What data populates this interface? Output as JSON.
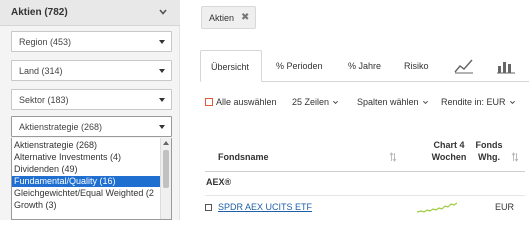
{
  "filter_panel": {
    "title": "Aktien (782)",
    "selects": {
      "region": "Region (453)",
      "land": "Land (314)",
      "sektor": "Sektor (183)",
      "strategie": "Aktienstrategie (268)"
    },
    "dropdown_options": [
      "Aktienstrategie (268)",
      "Alternative Investments (4)",
      "Dividenden (49)",
      "Fundamental/Quality (16)",
      "Gleichgewichtet/Equal Weighted (2",
      "Growth (3)"
    ],
    "selected_option_index": 3
  },
  "active_filter": {
    "label": "Aktien",
    "remove_symbol": "✖"
  },
  "tabs": {
    "overview": "Übersicht",
    "perioden": "% Perioden",
    "jahre": "% Jahre",
    "risiko": "Risiko",
    "chart_icon": "chart-line-icon",
    "bars_icon": "bar-chart-icon"
  },
  "toolbar": {
    "select_all": "Alle auswählen",
    "rows": "25 Zeilen",
    "columns": "Spalten wählen",
    "rendite": "Rendite in: EUR"
  },
  "table": {
    "col_name": "Fondsname",
    "col_chart_line1": "Chart 4",
    "col_chart_line2": "Wochen",
    "col_fonds_line1": "Fonds",
    "col_fonds_line2": "Whg.",
    "group": "AEX®",
    "rows": [
      {
        "name": "SPDR AEX UCITS ETF",
        "currency": "EUR"
      }
    ]
  },
  "colors": {
    "accent_checkbox": "#e05a3a",
    "selected_option": "#1e6fd0",
    "link": "#1f5fa8",
    "sparkline": "#9ccb3a"
  }
}
